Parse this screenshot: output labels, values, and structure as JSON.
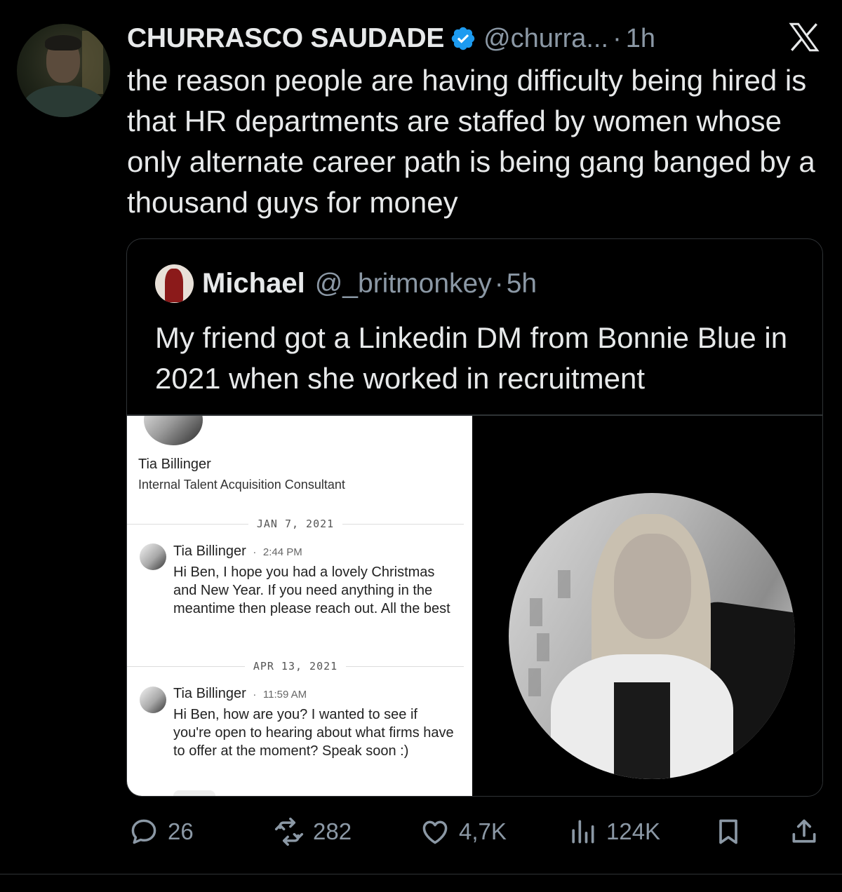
{
  "tweet": {
    "author_name": "CHURRASCO SAUDADE",
    "handle": "@churra...",
    "separator": "·",
    "time": "1h",
    "text": "the reason people are having difficulty being hired is that HR departments are staffed by women whose only alternate career path is being gang banged by a thousand guys for money",
    "verified": true,
    "verified_color": "#1d9bf0"
  },
  "quote": {
    "author_name": "Michael",
    "handle": "@_britmonkey",
    "separator": "·",
    "time": "5h",
    "text": "My friend got a Linkedin DM from Bonnie Blue in 2021 when she worked in recruitment",
    "screenshot": {
      "profile_name": "Tia Billinger",
      "profile_title": "Internal Talent Acquisition Consultant",
      "messages": [
        {
          "date": "JAN 7, 2021",
          "sender": "Tia Billinger",
          "time_prefix": "·",
          "time": "2:44 PM",
          "body": "Hi Ben, I hope you had a lovely Christmas and New Year. If you need anything in the meantime then please reach out. All the best"
        },
        {
          "date": "APR 13, 2021",
          "sender": "Tia Billinger",
          "time_prefix": "·",
          "time": "11:59 AM",
          "body": "Hi Ben, how are you? I wanted to see if you're open to hearing about what firms have to offer at the moment? Speak soon :)"
        }
      ]
    }
  },
  "actions": {
    "replies": "26",
    "reposts": "282",
    "likes": "4,7K",
    "views": "124K"
  },
  "icons": [
    "x-logo-icon",
    "verified-badge-icon",
    "reply-icon",
    "repost-icon",
    "like-icon",
    "views-icon",
    "bookmark-icon",
    "share-icon"
  ]
}
